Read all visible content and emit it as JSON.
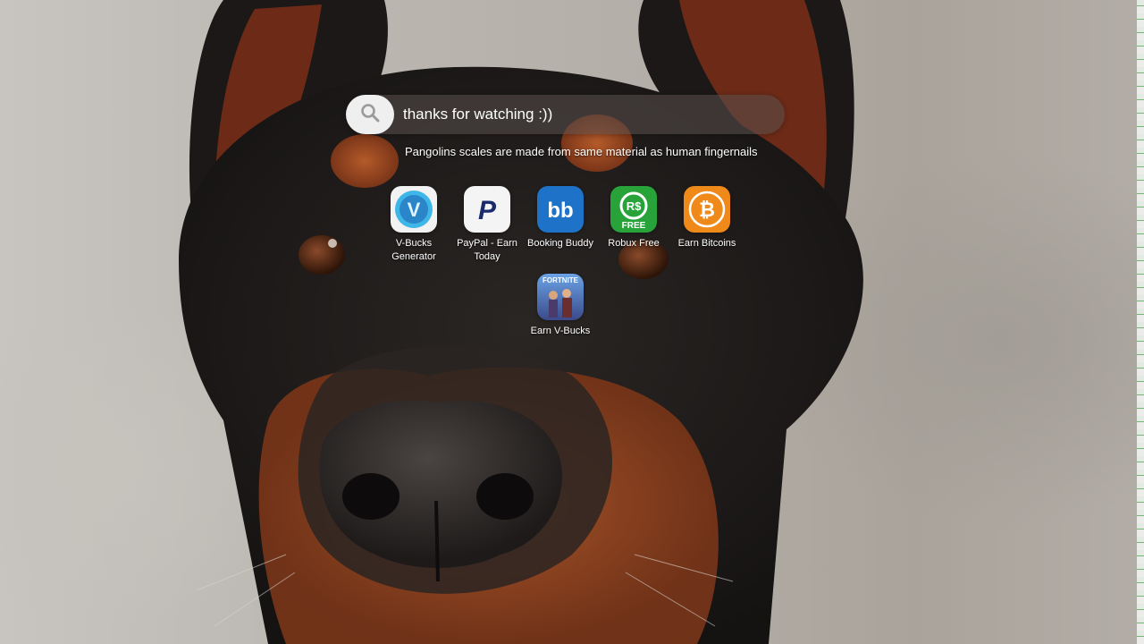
{
  "search": {
    "value": "thanks for watching :))",
    "fact": "Pangolins scales are made from same material as human fingernails"
  },
  "apps": [
    {
      "label": "V-Bucks Generator",
      "icon": "v-bucks-icon"
    },
    {
      "label": "PayPal - Earn Today",
      "icon": "paypal-icon"
    },
    {
      "label": "Booking Buddy",
      "icon": "booking-buddy-icon"
    },
    {
      "label": "Robux Free",
      "icon": "robux-icon"
    },
    {
      "label": "Earn Bitcoins",
      "icon": "bitcoin-icon"
    },
    {
      "label": "Earn V-Bucks",
      "icon": "fortnite-icon"
    }
  ],
  "icon_text": {
    "paypal": "P",
    "booking": "bb",
    "robux": "R$",
    "robux_free": "FREE",
    "bitcoin": "₿",
    "fortnite": "FORTNITE",
    "vbucks": "V"
  },
  "colors": {
    "booking_bg": "#1e73c8",
    "robux_bg": "#27a33a",
    "bitcoin_bg": "#ef8a1a",
    "paypal_fg": "#1a2b6d"
  }
}
